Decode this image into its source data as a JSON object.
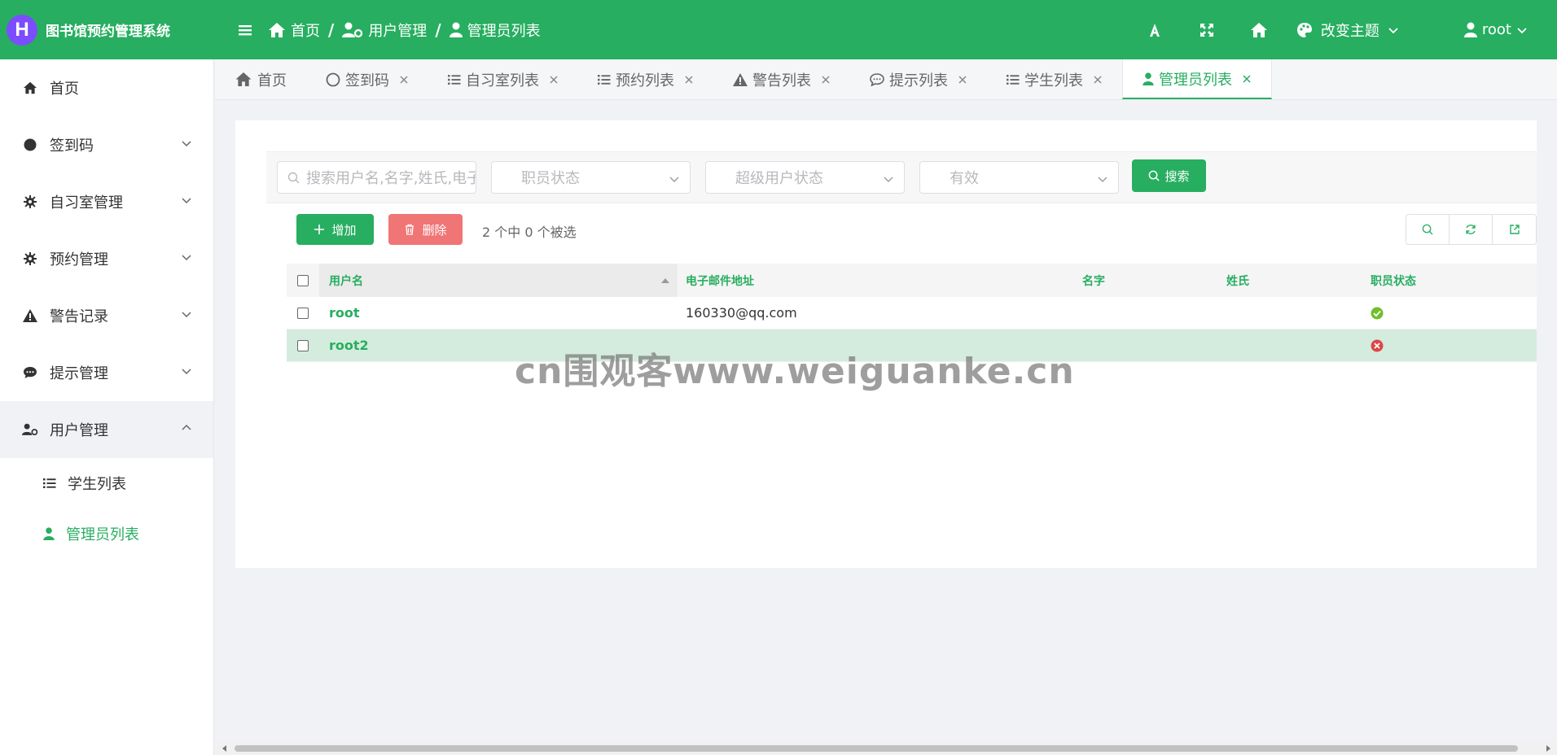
{
  "app": {
    "logo_letter": "H",
    "title": "图书馆预约管理系统"
  },
  "breadcrumb": {
    "home": "首页",
    "users": "用户管理",
    "admins": "管理员列表"
  },
  "header": {
    "theme_label": "改变主题",
    "user_label": "root"
  },
  "sidebar": {
    "items": [
      {
        "label": "首页",
        "icon": "home-icon"
      },
      {
        "label": "签到码",
        "icon": "circle-icon"
      },
      {
        "label": "自习室管理",
        "icon": "gear-icon"
      },
      {
        "label": "预约管理",
        "icon": "gear-icon"
      },
      {
        "label": "警告记录",
        "icon": "warning-icon"
      },
      {
        "label": "提示管理",
        "icon": "comment-icon"
      },
      {
        "label": "用户管理",
        "icon": "user-cog-icon"
      }
    ],
    "subitems": [
      {
        "label": "学生列表",
        "icon": "list-icon"
      },
      {
        "label": "管理员列表",
        "icon": "user-icon"
      }
    ]
  },
  "tabs": [
    {
      "label": "首页"
    },
    {
      "label": "签到码"
    },
    {
      "label": "自习室列表"
    },
    {
      "label": "预约列表"
    },
    {
      "label": "警告列表"
    },
    {
      "label": "提示列表"
    },
    {
      "label": "学生列表"
    },
    {
      "label": "管理员列表"
    }
  ],
  "search": {
    "placeholder": "搜索用户名,名字,姓氏,电子邮件地址",
    "staff_status": "职员状态",
    "superuser_status": "超级用户状态",
    "active": "有效",
    "search_label": "搜索"
  },
  "toolbar": {
    "add_label": "增加",
    "delete_label": "删除",
    "selection_info": "2 个中 0 个被选"
  },
  "table": {
    "columns": [
      "用户名",
      "电子邮件地址",
      "名字",
      "姓氏",
      "职员状态"
    ],
    "rows": [
      {
        "username": "root",
        "email": "160330@qq.com",
        "first_name": "",
        "last_name": "",
        "is_staff": true
      },
      {
        "username": "root2",
        "email": "",
        "first_name": "",
        "last_name": "",
        "is_staff": false
      }
    ]
  },
  "watermark": "cn围观客www.weiguanke.cn",
  "colors": {
    "primary": "#27ae60",
    "danger": "#f07575",
    "logo": "#7c4dff",
    "selected_row": "#d4ecdd"
  }
}
